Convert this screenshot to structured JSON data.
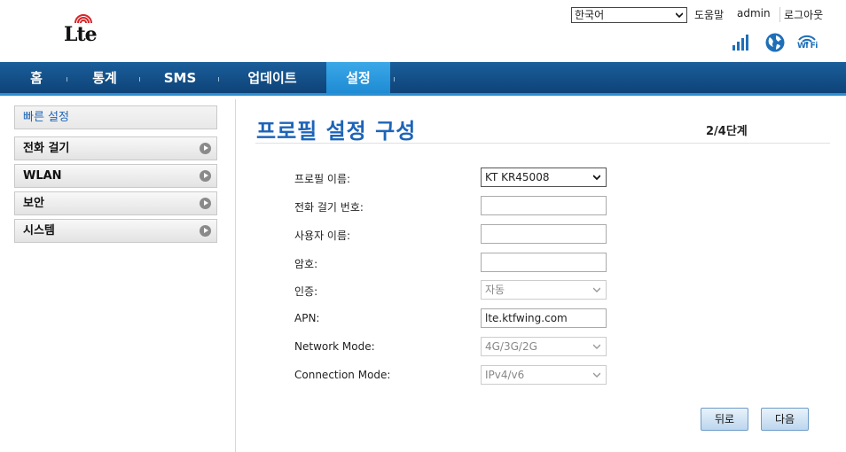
{
  "header": {
    "language": "한국어",
    "help": "도움말",
    "user": "admin",
    "logout": "로그아웃",
    "logo_text": "Lte",
    "wifi_text": "Wi Fi"
  },
  "nav": {
    "items": [
      {
        "label": "홈"
      },
      {
        "label": "통계"
      },
      {
        "label": "SMS"
      },
      {
        "label": "업데이트"
      },
      {
        "label": "설정"
      }
    ],
    "active": "설정"
  },
  "sidebar": {
    "items": [
      {
        "label": "빠른 설정"
      },
      {
        "label": "전화 걸기"
      },
      {
        "label": "WLAN"
      },
      {
        "label": "보안"
      },
      {
        "label": "시스템"
      }
    ]
  },
  "main": {
    "title": "프로필 설정 구성",
    "step": "2/4단계",
    "fields": {
      "profile_name": {
        "label": "프로필 이름:",
        "value": "KT KR45008"
      },
      "dial_number": {
        "label": "전화 걸기 번호:",
        "value": ""
      },
      "username": {
        "label": "사용자 이름:",
        "value": ""
      },
      "password": {
        "label": "암호:",
        "value": ""
      },
      "auth": {
        "label": "인증:",
        "value": "자동"
      },
      "apn": {
        "label": "APN:",
        "value": "lte.ktfwing.com"
      },
      "network_mode": {
        "label": "Network Mode:",
        "value": "4G/3G/2G"
      },
      "connection_mode": {
        "label": "Connection Mode:",
        "value": "IPv4/v6"
      }
    },
    "buttons": {
      "back": "뒤로",
      "next": "다음"
    }
  },
  "colors": {
    "nav_bg": "#0e4378",
    "nav_active": "#1e8bd3",
    "title_blue": "#1d64b8",
    "icon_blue": "#1f6fb8"
  }
}
